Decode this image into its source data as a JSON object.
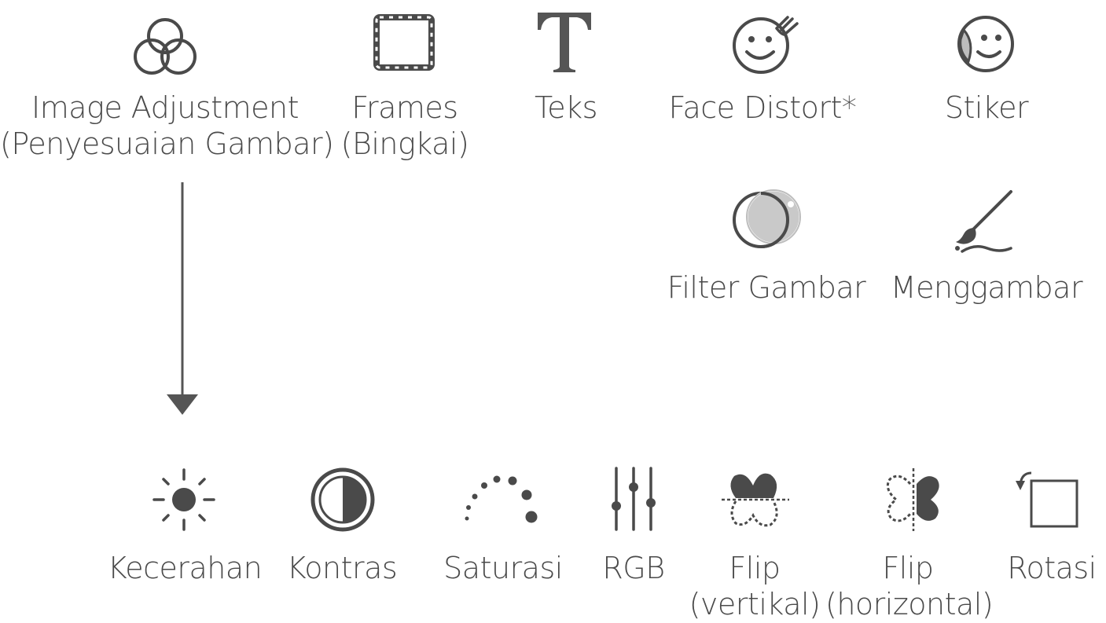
{
  "top_tools": [
    {
      "name": "image-adjustment",
      "line1": "Image Adjustment",
      "line2": "(Penyesuaian Gambar)",
      "icon": "venn-circles-icon"
    },
    {
      "name": "frames",
      "line1": "Frames",
      "line2": "(Bingkai)",
      "icon": "frame-icon"
    },
    {
      "name": "teks",
      "line1": "Teks",
      "line2": "",
      "icon": "text-t-icon"
    },
    {
      "name": "face-distort",
      "line1": "Face Distort*",
      "line2": "",
      "icon": "face-distort-icon"
    },
    {
      "name": "stiker",
      "line1": "Stiker",
      "line2": "",
      "icon": "sticker-icon"
    },
    {
      "name": "filter-gambar",
      "line1": "Filter Gambar",
      "line2": "",
      "icon": "filter-icon"
    },
    {
      "name": "menggambar",
      "line1": "Menggambar",
      "line2": "",
      "icon": "brush-icon"
    }
  ],
  "adjust_tools": [
    {
      "name": "kecerahan",
      "line1": "Kecerahan",
      "line2": "",
      "icon": "brightness-icon"
    },
    {
      "name": "kontras",
      "line1": "Kontras",
      "line2": "",
      "icon": "contrast-icon"
    },
    {
      "name": "saturasi",
      "line1": "Saturasi",
      "line2": "",
      "icon": "saturation-icon"
    },
    {
      "name": "rgb",
      "line1": "RGB",
      "line2": "",
      "icon": "rgb-sliders-icon"
    },
    {
      "name": "flip-vertikal",
      "line1": "Flip",
      "line2": "(vertikal)",
      "icon": "flip-vertical-icon"
    },
    {
      "name": "flip-horizontal",
      "line1": "Flip",
      "line2": "(horizontal)",
      "icon": "flip-horizontal-icon"
    },
    {
      "name": "rotasi",
      "line1": "Rotasi",
      "line2": "",
      "icon": "rotate-icon"
    }
  ],
  "colors": {
    "ink": "#4a4a4a",
    "fill": "#555555",
    "light": "#bdbdbd"
  }
}
